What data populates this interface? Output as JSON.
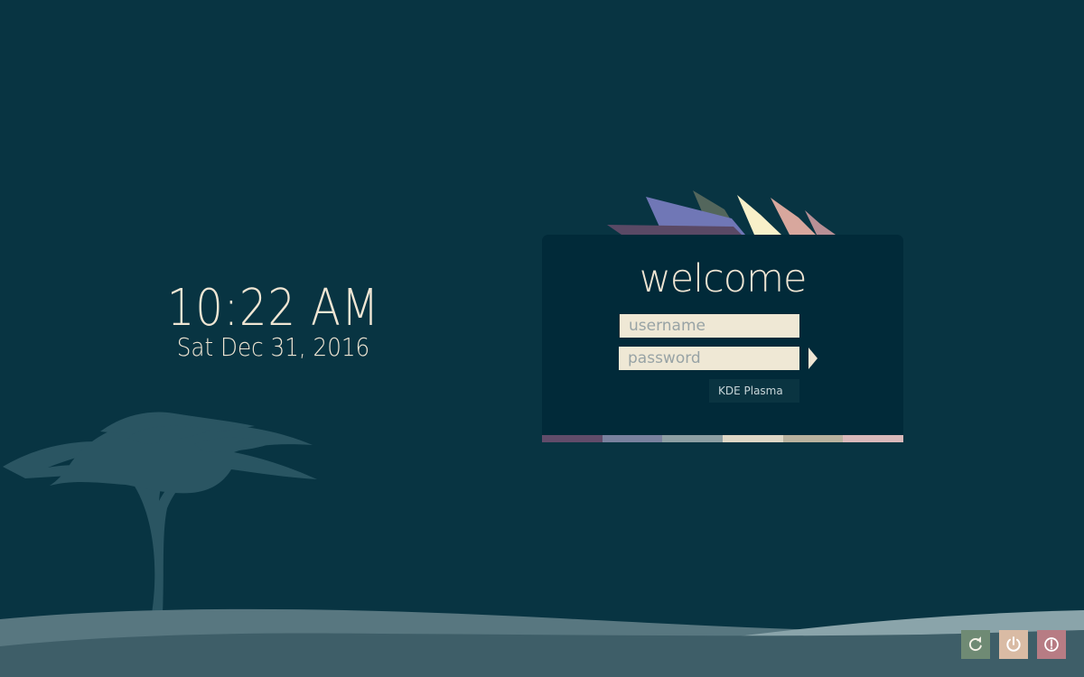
{
  "clock": {
    "time": "10:22 AM",
    "date": "Sat Dec 31, 2016"
  },
  "login": {
    "title": "welcome",
    "username_placeholder": "username",
    "password_placeholder": "password",
    "session": "KDE Plasma",
    "login_arrow_icon": "arrow-right-icon"
  },
  "power": {
    "reboot_icon": "reboot-icon",
    "shutdown_icon": "power-icon",
    "suspend_icon": "suspend-icon"
  },
  "colors": {
    "background": "#083442",
    "panel": "#012a39",
    "text": "#efe5d3",
    "field": "#efe8d5",
    "reboot": "#6f8a74",
    "shutdown": "#d9bba4",
    "suspend": "#b77c84",
    "stripe": [
      "#614c6a",
      "#79819e",
      "#8d9fa3",
      "#ded7c6",
      "#b9b29f",
      "#d9b9ba"
    ]
  }
}
